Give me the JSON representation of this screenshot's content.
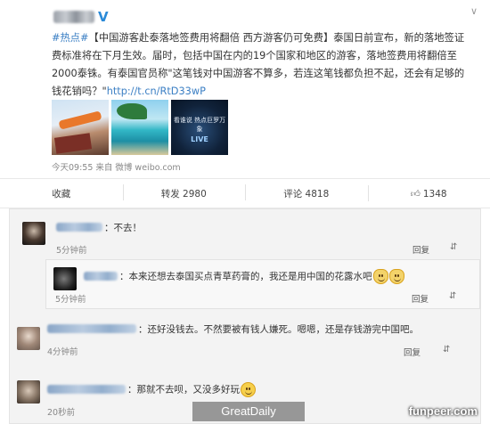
{
  "post": {
    "verified_mark": "V",
    "menu_chevron": "∨",
    "hashtag": "#热点#",
    "body": "【中国游客赴泰落地签费用将翻倍 西方游客仍可免费】泰国日前宣布，新的落地签证费标准将在下月生效。届时，包括中国在内的19个国家和地区的游客，落地签费用将翻倍至2000泰铢。有泰国官员称\"这笔钱对中国游客不算多，若连这笔钱都负担不起，还会有足够的钱花销吗？\"",
    "link": "http://t.cn/RtD33wP",
    "thumbnails": [
      {
        "name": "passport-plane-image"
      },
      {
        "name": "tropical-beach-image"
      },
      {
        "name": "tech-banner-image",
        "text": "看谁说 热点巨罗万象",
        "logo": "LIVE"
      }
    ],
    "meta": "今天09:55 来自 微博 weibo.com"
  },
  "actions": {
    "favorite": "收藏",
    "repost": "转发 2980",
    "comment": "评论 4818",
    "like_count": "1348",
    "like_icon": "thumb-up-icon"
  },
  "comments": [
    {
      "text": "不去！",
      "time": "5分钟前",
      "reply": "回复"
    },
    {
      "text": "本来还想去泰国买点青草药膏的，我还是用中国的花露水吧",
      "time": "5分钟前",
      "reply": "回复"
    },
    {
      "text": "还好没钱去。不然要被有钱人嫌死。嗯嗯，还是存钱游完中国吧。",
      "time": "4分钟前",
      "reply": "回复"
    },
    {
      "text": "那就不去呗，又没多好玩",
      "time": "20秒前",
      "reply": "回复"
    }
  ],
  "watermarks": {
    "left": "GreatDaily",
    "right": "funpeer.com"
  },
  "colors": {
    "link": "#3b7fc4",
    "verified": "#2a8ad8",
    "emoji": "#f6cf4b"
  }
}
